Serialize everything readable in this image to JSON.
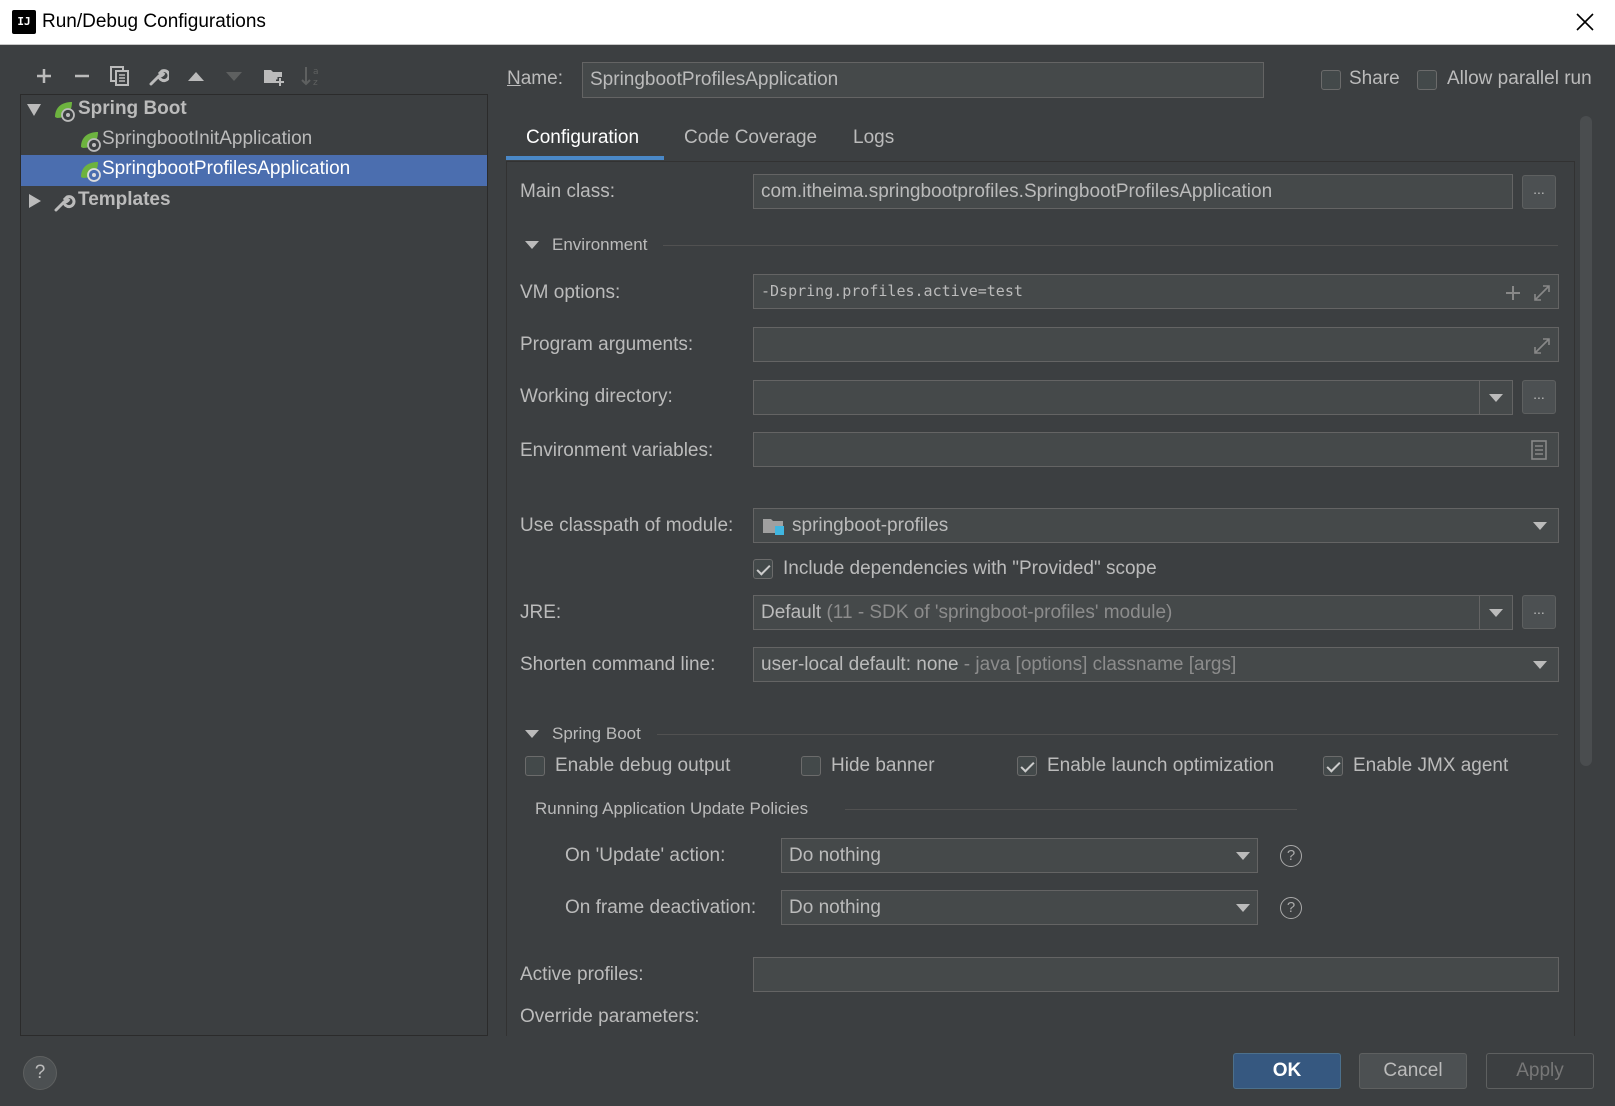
{
  "window": {
    "title": "Run/Debug Configurations",
    "app_icon": "IJ"
  },
  "toolbar": {
    "icons": [
      "add-icon",
      "remove-icon",
      "copy-icon",
      "wrench-icon",
      "move-up-icon",
      "move-down-icon",
      "new-folder-icon",
      "sort-icon"
    ]
  },
  "tree": {
    "root_label": "Spring Boot",
    "children": [
      "SpringbootInitApplication",
      "SpringbootProfilesApplication"
    ],
    "templates_label": "Templates"
  },
  "header": {
    "name_label": "Name:",
    "name_value": "SpringbootProfilesApplication",
    "share_label": "Share",
    "allow_parallel_label": "Allow parallel run"
  },
  "tabs": [
    "Configuration",
    "Code Coverage",
    "Logs"
  ],
  "config": {
    "main_class_label": "Main class:",
    "main_class_value": "com.itheima.springbootprofiles.SpringbootProfilesApplication",
    "environment_label": "Environment",
    "vm_options_label": "VM options:",
    "vm_options_value": "-Dspring.profiles.active=test",
    "program_args_label": "Program arguments:",
    "working_dir_label": "Working directory:",
    "env_vars_label": "Environment variables:",
    "classpath_label": "Use classpath of module:",
    "classpath_value": "springboot-profiles",
    "include_deps_label": "Include dependencies with \"Provided\" scope",
    "jre_label": "JRE:",
    "jre_value": "Default",
    "jre_detail": "(11 - SDK of 'springboot-profiles' module)",
    "shorten_label": "Shorten command line:",
    "shorten_value": "user-local default: none",
    "shorten_detail": "- java [options] classname [args]",
    "ellipsis": "..."
  },
  "spring_boot": {
    "section_label": "Spring Boot",
    "enable_debug_label": "Enable debug output",
    "hide_banner_label": "Hide banner",
    "launch_opt_label": "Enable launch optimization",
    "jmx_label": "Enable JMX agent",
    "policies_label": "Running Application Update Policies",
    "update_action_label": "On 'Update' action:",
    "update_action_value": "Do nothing",
    "frame_deact_label": "On frame deactivation:",
    "frame_deact_value": "Do nothing",
    "active_profiles_label": "Active profiles:",
    "override_params_label": "Override parameters:"
  },
  "footer": {
    "ok": "OK",
    "cancel": "Cancel",
    "apply": "Apply",
    "help": "?"
  },
  "colors": {
    "background": "#3c3f41",
    "selection": "#4b6eaf",
    "accent": "#4a88c7",
    "ok_button": "#365880",
    "spring_green": "#6db33f"
  }
}
